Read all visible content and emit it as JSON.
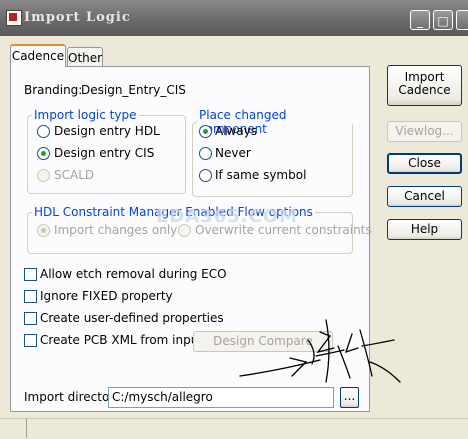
{
  "window": {
    "title": "Import Logic"
  },
  "tabs": [
    {
      "label": "Cadence"
    },
    {
      "label": "Other"
    }
  ],
  "branding": {
    "label": "Branding:",
    "value": "Design_Entry_CIS"
  },
  "import_logic_type": {
    "legend": "Import logic type",
    "options": [
      {
        "label": "Design entry HDL",
        "selected": false,
        "enabled": true
      },
      {
        "label": "Design entry CIS",
        "selected": true,
        "enabled": true
      },
      {
        "label": "SCALD",
        "selected": false,
        "enabled": false
      }
    ]
  },
  "place_changed": {
    "legend": "Place changed component",
    "options": [
      {
        "label": "Always",
        "selected": true
      },
      {
        "label": "Never",
        "selected": false
      },
      {
        "label": "If same symbol",
        "selected": false
      }
    ]
  },
  "hdl_flow": {
    "legend": "HDL Constraint Manager Enabled Flow options",
    "options": [
      {
        "label": "Import changes only",
        "selected": true
      },
      {
        "label": "Overwrite current constraints",
        "selected": false
      }
    ]
  },
  "checkboxes": [
    {
      "label": "Allow etch removal during ECO",
      "checked": false
    },
    {
      "label": "Ignore FIXED property",
      "checked": false
    },
    {
      "label": "Create user-defined properties",
      "checked": false
    },
    {
      "label": "Create PCB XML from input data",
      "checked": false
    }
  ],
  "design_compare_label": "Design Compare",
  "import_directory": {
    "label": "Import directory:",
    "value": "C:/mysch/allegro",
    "browse_label": "..."
  },
  "buttons": {
    "import_cadence_line1": "Import",
    "import_cadence_line2": "Cadence",
    "viewlog": "Viewlog...",
    "close": "Close",
    "cancel": "Cancel",
    "help": "Help"
  },
  "watermark": "EDA365.COM",
  "colors": {
    "accent_blue": "#0046d5",
    "title_bar": "#6d6d6d",
    "radio_dot": "#21a121"
  },
  "icons": {
    "app": "app-icon",
    "minimize": "minimize-icon",
    "maximize": "maximize-icon",
    "close": "close-icon"
  }
}
